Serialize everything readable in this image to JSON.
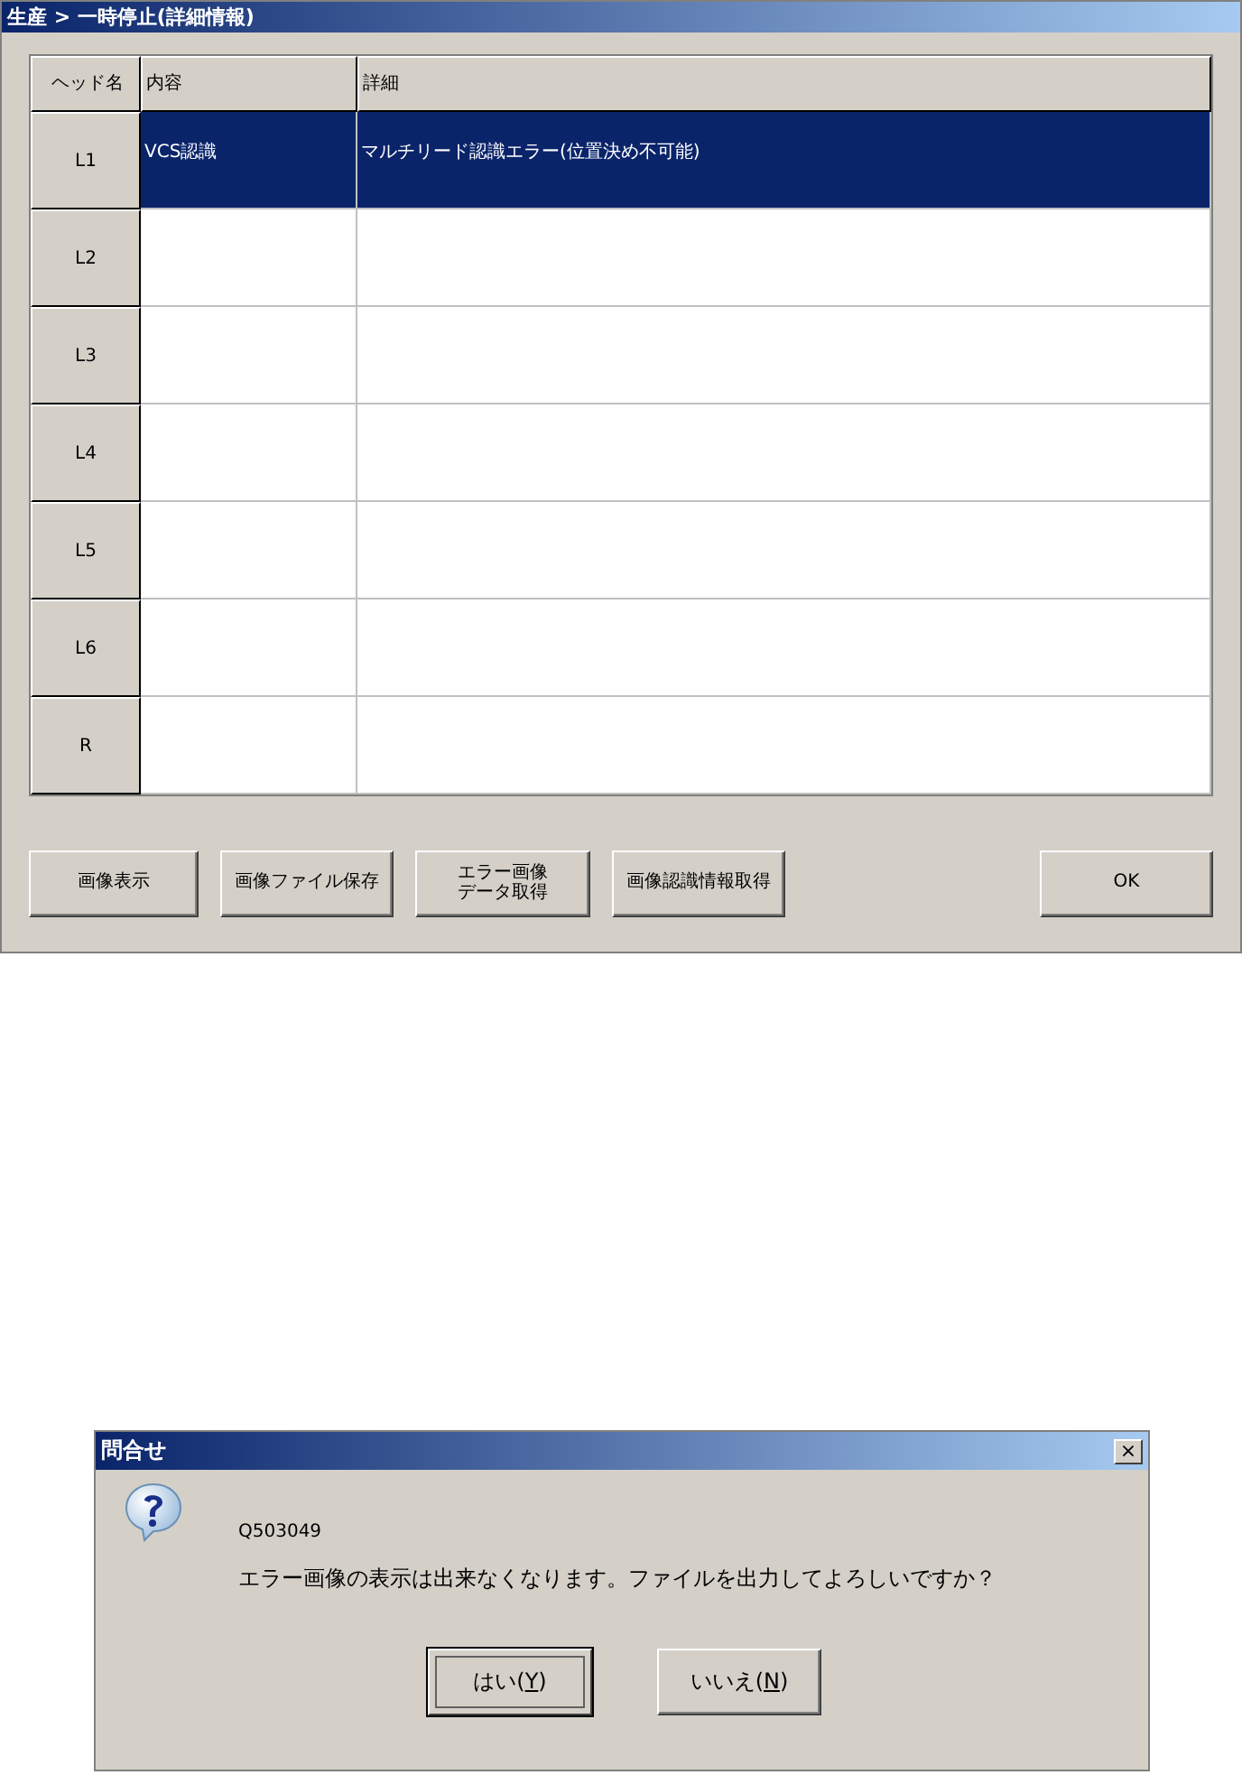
{
  "main_window": {
    "title": "生産 > 一時停止(詳細情報)",
    "table": {
      "columns": [
        "ヘッド名",
        "内容",
        "詳細"
      ],
      "rows": [
        {
          "head": "L1",
          "content": "VCS認識",
          "detail": "マルチリード認識エラー(位置決め不可能)",
          "selected": true
        },
        {
          "head": "L2",
          "content": "",
          "detail": "",
          "selected": false
        },
        {
          "head": "L3",
          "content": "",
          "detail": "",
          "selected": false
        },
        {
          "head": "L4",
          "content": "",
          "detail": "",
          "selected": false
        },
        {
          "head": "L5",
          "content": "",
          "detail": "",
          "selected": false
        },
        {
          "head": "L6",
          "content": "",
          "detail": "",
          "selected": false
        },
        {
          "head": "R",
          "content": "",
          "detail": "",
          "selected": false
        }
      ]
    },
    "buttons": [
      {
        "label": "画像表示"
      },
      {
        "label": "画像ファイル保存"
      },
      {
        "lines": [
          "エラー画像",
          "データ取得"
        ]
      },
      {
        "label": "画像認識情報取得"
      },
      {
        "label": "OK"
      }
    ]
  },
  "dialog": {
    "title": "問合せ",
    "close": "×",
    "code": "Q503049",
    "message": "エラー画像の表示は出来なくなります。ファイルを出力してよろしいですか？",
    "buttons": [
      {
        "label": "はい(",
        "key": "Y",
        "after": ")",
        "default": true
      },
      {
        "label": "いいえ(",
        "key": "N",
        "after": ")",
        "default": false
      }
    ]
  }
}
